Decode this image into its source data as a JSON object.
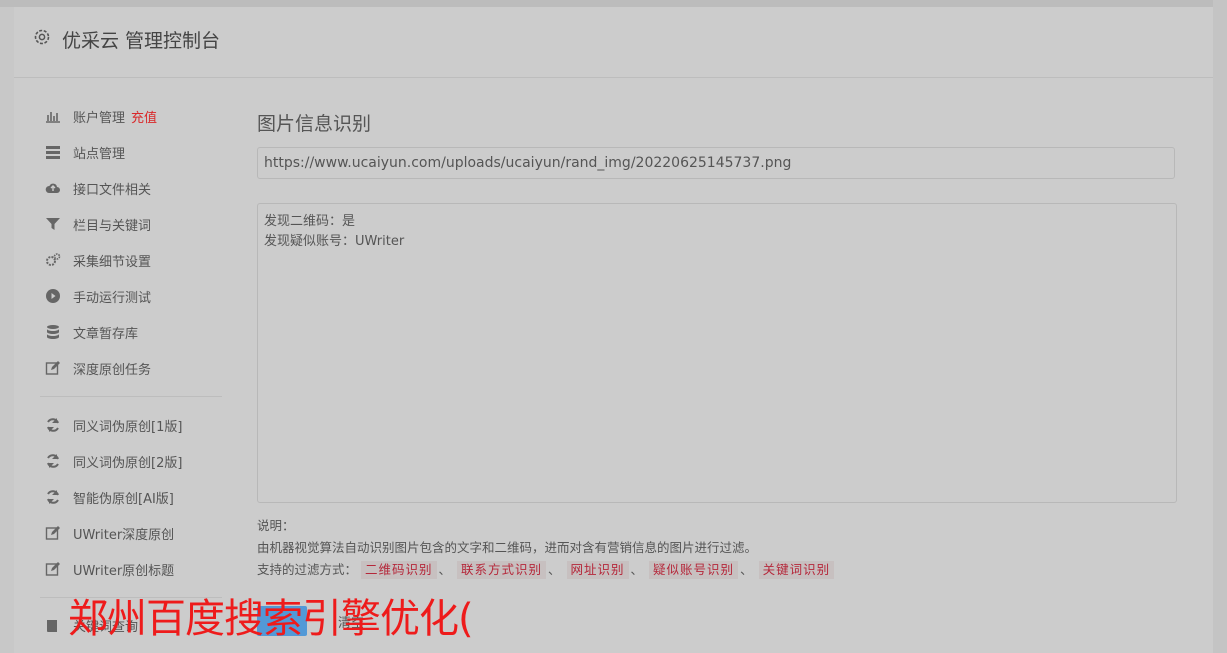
{
  "header": {
    "title": "优采云 管理控制台"
  },
  "sidebar": {
    "items": [
      {
        "label": "账户管理",
        "badge": "充值",
        "icon": "bar-chart-icon"
      },
      {
        "label": "站点管理",
        "icon": "list-icon"
      },
      {
        "label": "接口文件相关",
        "icon": "cloud-upload-icon"
      },
      {
        "label": "栏目与关键词",
        "icon": "filter-icon"
      },
      {
        "label": "采集细节设置",
        "icon": "gears-icon"
      },
      {
        "label": "手动运行测试",
        "icon": "play-circle-icon"
      },
      {
        "label": "文章暂存库",
        "icon": "database-icon"
      },
      {
        "label": "深度原创任务",
        "icon": "edit-icon"
      },
      {
        "label": "同义词伪原创[1版]",
        "icon": "refresh-icon"
      },
      {
        "label": "同义词伪原创[2版]",
        "icon": "refresh-icon"
      },
      {
        "label": "智能伪原创[AI版]",
        "icon": "refresh-icon"
      },
      {
        "label": "UWriter深度原创",
        "icon": "edit-icon"
      },
      {
        "label": "UWriter原创标题",
        "icon": "edit-icon"
      }
    ],
    "bottom_item": {
      "label": "关键词查询",
      "icon": "book-icon"
    }
  },
  "main": {
    "title": "图片信息识别",
    "url_value": "https://www.ucaiyun.com/uploads/ucaiyun/rand_img/20220625145737.png",
    "result_lines": [
      "发现二维码：是",
      "发现疑似账号：UWriter"
    ],
    "notes_label": "说明：",
    "notes_desc": "由机器视觉算法自动识别图片包含的文字和二维码，进而对含有营销信息的图片进行过滤。",
    "filter_label": "支持的过滤方式：",
    "filter_tags": [
      "二维码识别",
      "联系方式识别",
      "网址识别",
      "疑似账号识别",
      "关键词识别"
    ],
    "tag_separator": "、",
    "clear_button": "清空"
  },
  "overlay": {
    "text": "郑州百度搜索引擎优化("
  },
  "colors": {
    "accent_red": "#d9282a",
    "tag_text": "#b5273a",
    "button_blue": "#3c8fd8",
    "overlay_red": "#ee1b1b"
  }
}
